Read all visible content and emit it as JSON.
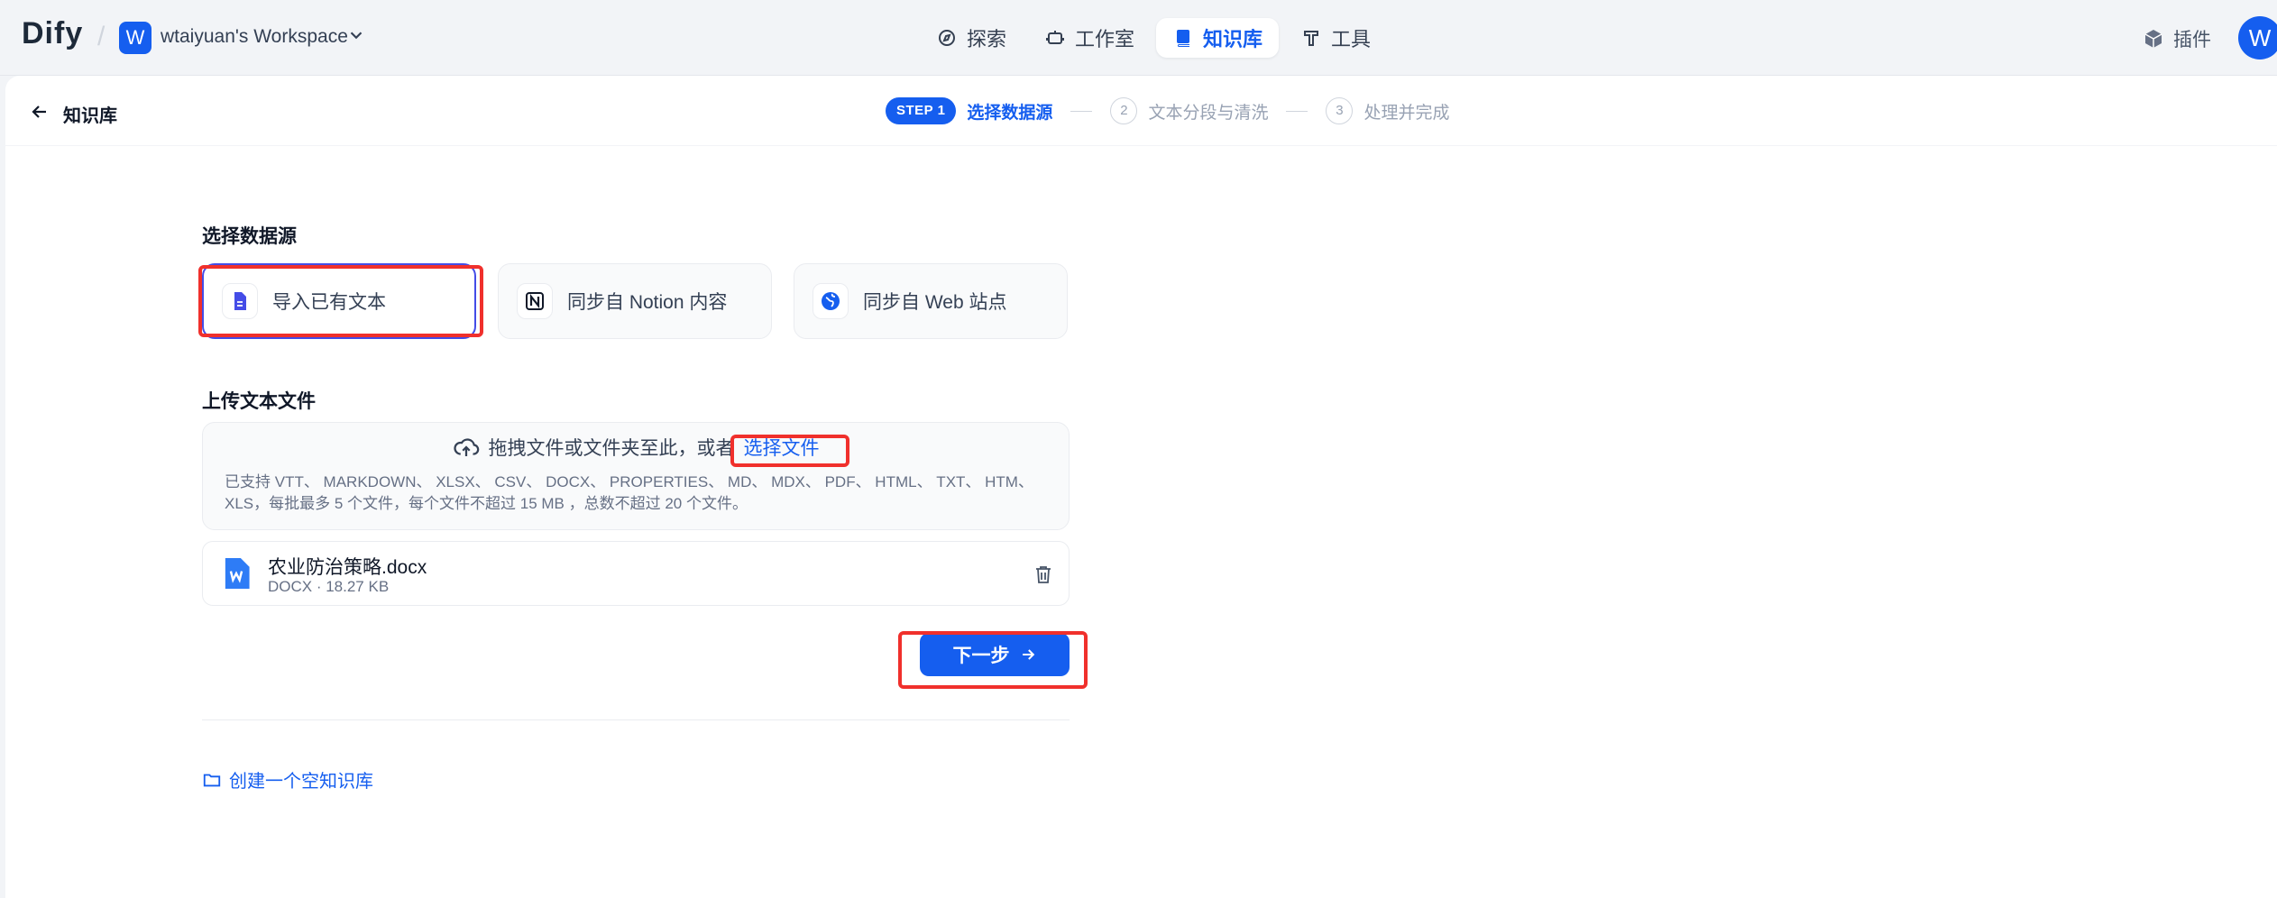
{
  "header": {
    "logo": "Dify",
    "workspace_initial": "W",
    "workspace_name": "wtaiyuan's Workspace",
    "nav": [
      {
        "label": "探索",
        "icon": "compass-icon",
        "active": false
      },
      {
        "label": "工作室",
        "icon": "robot-icon",
        "active": false
      },
      {
        "label": "知识库",
        "icon": "book-icon",
        "active": true
      },
      {
        "label": "工具",
        "icon": "hammer-icon",
        "active": false
      }
    ],
    "plugin_label": "插件",
    "user_initial": "W"
  },
  "subheader": {
    "back_label": "知识库",
    "steps": [
      {
        "badge": "STEP 1",
        "label": "选择数据源",
        "active": true
      },
      {
        "badge": "2",
        "label": "文本分段与清洗",
        "active": false
      },
      {
        "badge": "3",
        "label": "处理并完成",
        "active": false
      }
    ]
  },
  "datasource": {
    "title": "选择数据源",
    "options": [
      {
        "label": "导入已有文本",
        "icon": "document-icon",
        "active": true
      },
      {
        "label": "同步自 Notion 内容",
        "icon": "notion-icon",
        "active": false
      },
      {
        "label": "同步自 Web 站点",
        "icon": "globe-icon",
        "active": false
      }
    ]
  },
  "upload": {
    "title": "上传文本文件",
    "drop_text": "拖拽文件或文件夹至此，或者",
    "select_link": "选择文件",
    "hint": "已支持 VTT、 MARKDOWN、 XLSX、 CSV、 DOCX、 PROPERTIES、 MD、 MDX、 PDF、 HTML、 TXT、 HTM、 XLS，每批最多 5 个文件，每个文件不超过 15 MB ，总数不超过 20 个文件。"
  },
  "file": {
    "name": "农业防治策略.docx",
    "meta": "DOCX · 18.27 KB"
  },
  "actions": {
    "next_label": "下一步",
    "empty_kb_label": "创建一个空知识库"
  },
  "colors": {
    "accent": "#155eef",
    "highlight": "#f0302c"
  }
}
